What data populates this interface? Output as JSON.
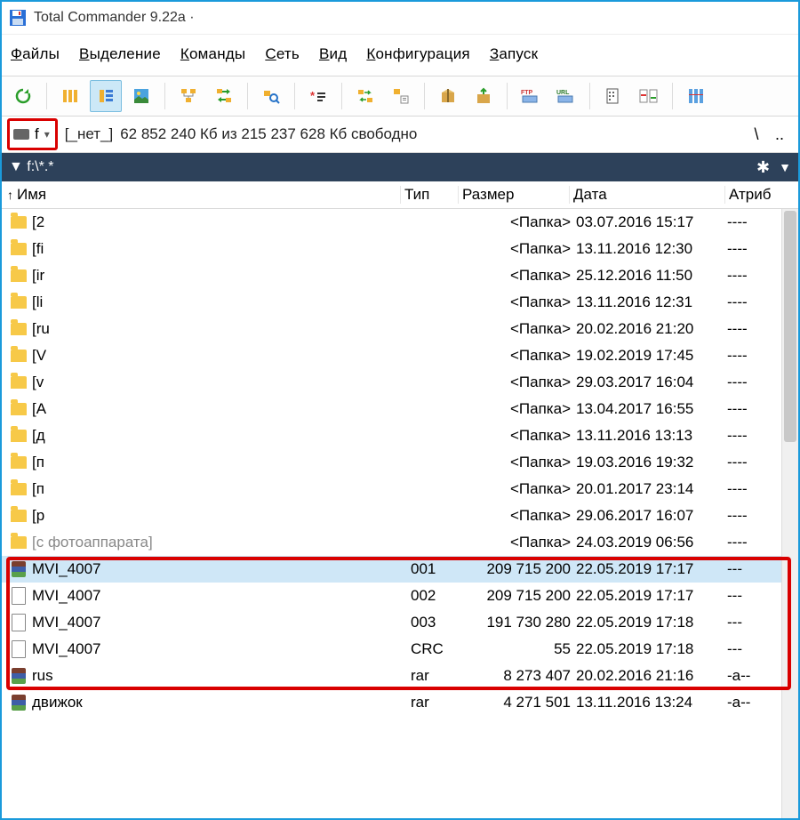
{
  "title": "Total Commander 9.22a ·",
  "menu": {
    "files": {
      "u": "Ф",
      "rest": "айлы"
    },
    "select": {
      "u": "В",
      "rest": "ыделение"
    },
    "commands": {
      "u": "К",
      "rest": "оманды"
    },
    "net": {
      "u": "С",
      "rest": "еть"
    },
    "view": {
      "u": "В",
      "rest": "ид"
    },
    "config": {
      "u": "К",
      "rest": "онфигурация"
    },
    "start": {
      "u": "З",
      "rest": "апуск"
    }
  },
  "drive": {
    "letter": "f",
    "label": "[_нет_]",
    "space": "62 852 240 Кб из 215 237 628 Кб свободно",
    "root": "\\",
    "up": ".."
  },
  "path": "▼ f:\\*.*",
  "columns": {
    "name": "Имя",
    "type": "Тип",
    "size": "Размер",
    "date": "Дата",
    "attr": "Атриб"
  },
  "rows": [
    {
      "kind": "folder",
      "name": "[2",
      "type": "",
      "size": "<Папка>",
      "date": "03.07.2016 15:17",
      "attr": "----"
    },
    {
      "kind": "folder",
      "name": "[fi",
      "type": "",
      "size": "<Папка>",
      "date": "13.11.2016 12:30",
      "attr": "----"
    },
    {
      "kind": "folder",
      "name": "[ir",
      "type": "",
      "size": "<Папка>",
      "date": "25.12.2016 11:50",
      "attr": "----"
    },
    {
      "kind": "folder",
      "name": "[li",
      "type": "",
      "size": "<Папка>",
      "date": "13.11.2016 12:31",
      "attr": "----"
    },
    {
      "kind": "folder",
      "name": "[ru",
      "type": "",
      "size": "<Папка>",
      "date": "20.02.2016 21:20",
      "attr": "----"
    },
    {
      "kind": "folder",
      "name": "[V",
      "type": "",
      "size": "<Папка>",
      "date": "19.02.2019 17:45",
      "attr": "----"
    },
    {
      "kind": "folder",
      "name": "[v",
      "type": "",
      "size": "<Папка>",
      "date": "29.03.2017 16:04",
      "attr": "----"
    },
    {
      "kind": "folder",
      "name": "[A",
      "type": "",
      "size": "<Папка>",
      "date": "13.04.2017 16:55",
      "attr": "----"
    },
    {
      "kind": "folder",
      "name": "[д",
      "type": "",
      "size": "<Папка>",
      "date": "13.11.2016 13:13",
      "attr": "----"
    },
    {
      "kind": "folder",
      "name": "[п",
      "type": "",
      "size": "<Папка>",
      "date": "19.03.2016 19:32",
      "attr": "----"
    },
    {
      "kind": "folder",
      "name": "[п",
      "type": "",
      "size": "<Папка>",
      "date": "20.01.2017 23:14",
      "attr": "----"
    },
    {
      "kind": "folder",
      "name": "[р",
      "type": "",
      "size": "<Папка>",
      "date": "29.06.2017 16:07",
      "attr": "----"
    },
    {
      "kind": "folder",
      "name": "[с фотоаппарата]",
      "type": "",
      "size": "<Папка>",
      "date": "24.03.2019 06:56",
      "attr": "----",
      "cut": true
    },
    {
      "kind": "rar",
      "name": "MVI_4007",
      "type": "001",
      "size": "209 715 200",
      "date": "22.05.2019 17:17",
      "attr": "---",
      "sel": true
    },
    {
      "kind": "file",
      "name": "MVI_4007",
      "type": "002",
      "size": "209 715 200",
      "date": "22.05.2019 17:17",
      "attr": "---"
    },
    {
      "kind": "file",
      "name": "MVI_4007",
      "type": "003",
      "size": "191 730 280",
      "date": "22.05.2019 17:18",
      "attr": "---"
    },
    {
      "kind": "file",
      "name": "MVI_4007",
      "type": "CRC",
      "size": "55",
      "date": "22.05.2019 17:18",
      "attr": "---"
    },
    {
      "kind": "rar",
      "name": "rus",
      "type": "rar",
      "size": "8 273 407",
      "date": "20.02.2016 21:16",
      "attr": "-a--"
    },
    {
      "kind": "rar",
      "name": "движок",
      "type": "rar",
      "size": "4 271 501",
      "date": "13.11.2016 13:24",
      "attr": "-a--"
    }
  ],
  "toolbar_ftp": "FTP",
  "toolbar_url": "URL"
}
